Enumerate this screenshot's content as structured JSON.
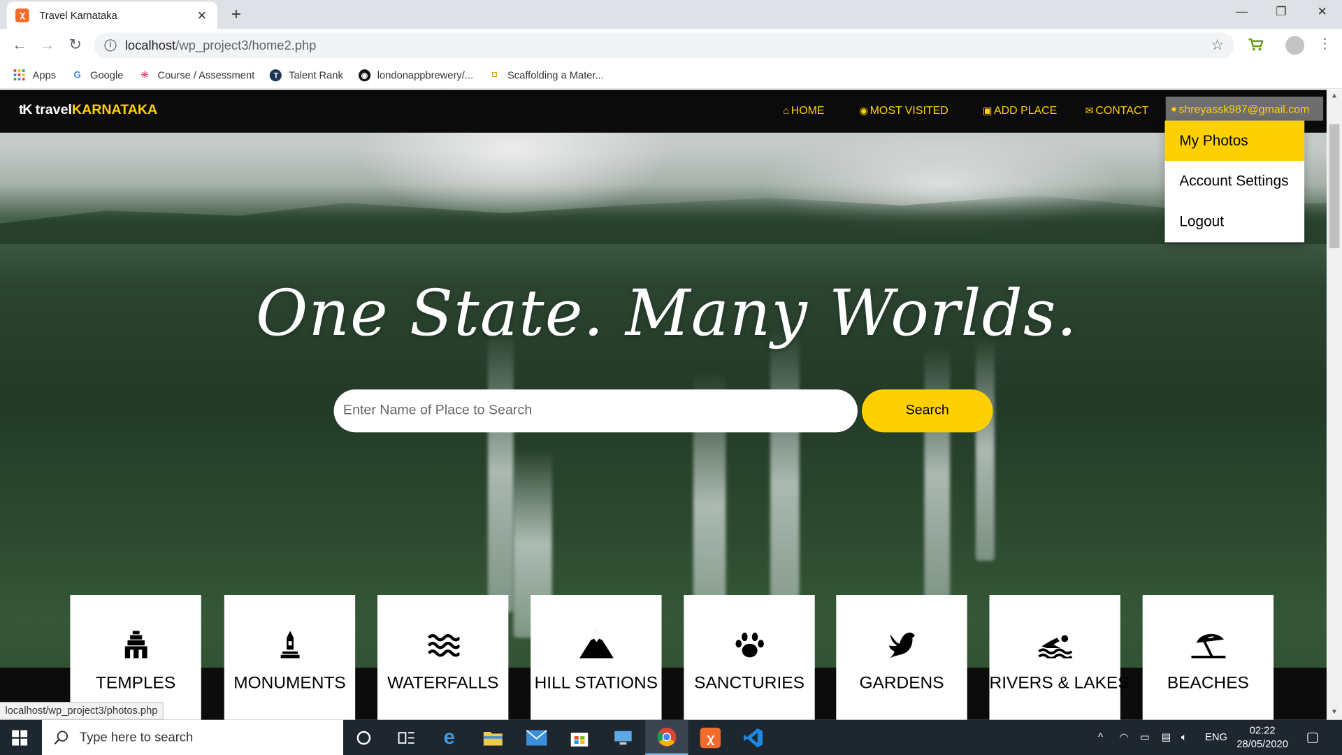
{
  "browser": {
    "tab_title": "Travel Karnataka",
    "tab_favicon": "xampp-icon",
    "new_tab_symbol": "+",
    "url_host": "localhost",
    "url_path": "/wp_project3/home2.php",
    "bookmarks": [
      {
        "label": "Apps",
        "icon": "apps-grid-icon"
      },
      {
        "label": "Google",
        "icon": "google-icon"
      },
      {
        "label": "Course / Assessment",
        "icon": "course-icon"
      },
      {
        "label": "Talent Rank",
        "icon": "talent-rank-icon"
      },
      {
        "label": "londonappbrewery/...",
        "icon": "github-icon"
      },
      {
        "label": "Scaffolding a Mater...",
        "icon": "scaffolding-icon"
      }
    ],
    "status_link": "localhost/wp_project3/photos.php"
  },
  "site": {
    "brand_logo": "tK",
    "brand_travel": "travel",
    "brand_state": "KARNATAKA",
    "nav": [
      {
        "label": "HOME",
        "icon": "home-icon"
      },
      {
        "label": "MOST VISITED",
        "icon": "eye-icon"
      },
      {
        "label": "ADD PLACE",
        "icon": "camera-icon"
      },
      {
        "label": "CONTACT",
        "icon": "envelope-icon"
      }
    ],
    "user_email": "shreyassk987@gmail.com",
    "dropdown": [
      "My Photos",
      "Account Settings",
      "Logout"
    ],
    "headline": "One State. Many Worlds.",
    "search_placeholder": "Enter Name of Place to Search",
    "search_button": "Search",
    "categories": [
      {
        "label": "TEMPLES",
        "icon": "temple-icon"
      },
      {
        "label": "MONUMENTS",
        "icon": "monument-icon"
      },
      {
        "label": "WATERFALLS",
        "icon": "water-icon"
      },
      {
        "label": "HILL STATIONS",
        "icon": "mountain-icon"
      },
      {
        "label": "SANCTURIES",
        "icon": "paw-icon"
      },
      {
        "label": "GARDENS",
        "icon": "dove-icon"
      },
      {
        "label": "RIVERS & LAKES",
        "icon": "swimmer-icon"
      },
      {
        "label": "BEACHES",
        "icon": "umbrella-beach-icon"
      }
    ],
    "accent_color": "#ffd000"
  },
  "taskbar": {
    "search_text": "Type here to search",
    "language": "ENG",
    "time": "02:22",
    "date": "28/05/2020"
  }
}
